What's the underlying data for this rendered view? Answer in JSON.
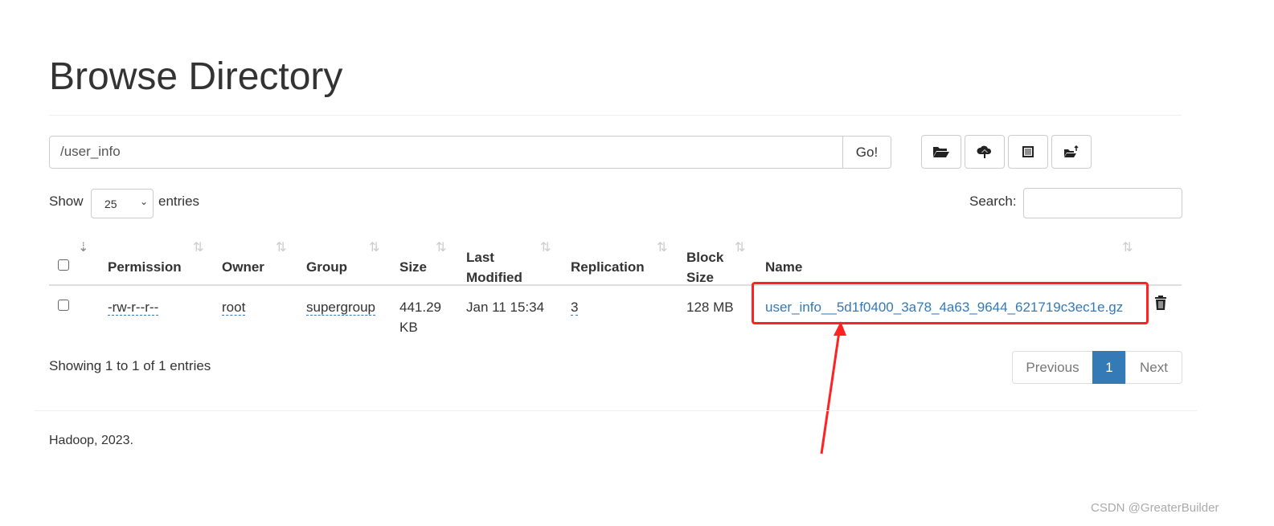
{
  "title": "Browse Directory",
  "path_input": {
    "value": "/user_info"
  },
  "go_label": "Go!",
  "toolbar": [
    {
      "icon": "folder-open-icon"
    },
    {
      "icon": "cloud-upload-icon"
    },
    {
      "icon": "list-alt-icon"
    },
    {
      "icon": "folder-move-icon"
    }
  ],
  "show": {
    "prefix": "Show",
    "value": "25",
    "suffix": "entries"
  },
  "search_label": "Search:",
  "columns": [
    "Permission",
    "Owner",
    "Group",
    "Size",
    "Last Modified",
    "Replication",
    "Block Size",
    "Name"
  ],
  "rows": [
    {
      "permission": "-rw-r--r--",
      "owner": "root",
      "group": "supergroup",
      "size": "441.29 KB",
      "modified": "Jan 11 15:34",
      "replication": "3",
      "block_size": "128 MB",
      "name": "user_info__5d1f0400_3a78_4a63_9644_621719c3ec1e.gz"
    }
  ],
  "info": "Showing 1 to 1 of 1 entries",
  "pagination": {
    "previous": "Previous",
    "current": "1",
    "next": "Next"
  },
  "footer": "Hadoop, 2023.",
  "watermark": "CSDN @GreaterBuilder",
  "colors": {
    "link": "#337ab7",
    "highlight": "#ff2222"
  }
}
